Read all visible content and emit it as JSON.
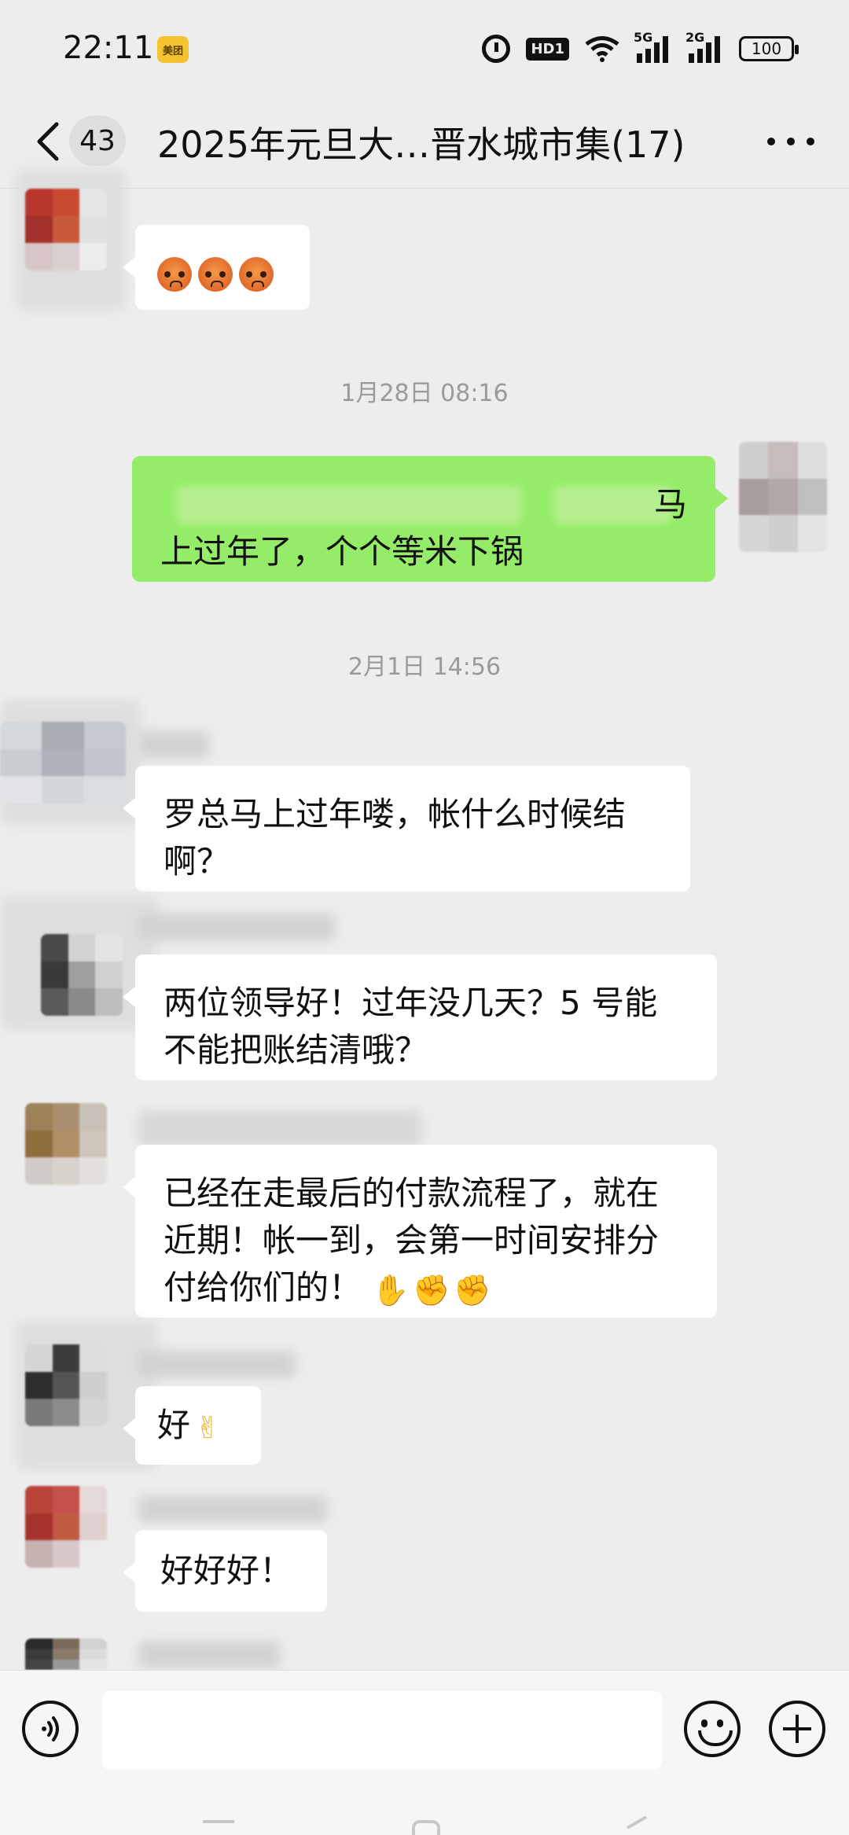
{
  "status_bar": {
    "time": "22:11",
    "app_badge": "美团",
    "hd_label": "HD1",
    "signal_1_label": "5G",
    "signal_2_label": "2G",
    "battery": "100",
    "icons": [
      "alarm-icon",
      "wifi-icon",
      "signal-icon",
      "battery-icon"
    ]
  },
  "header": {
    "unread_count": "43",
    "title": "2025年元旦大…晋水城市集(17)",
    "icons": [
      "back-chevron-icon",
      "more-dots-icon"
    ]
  },
  "messages": {
    "m1": {
      "side": "left",
      "emojis": [
        "sweat-face-emoji",
        "sweat-face-emoji",
        "sweat-face-emoji"
      ]
    },
    "ts1": "1月28日 08:16",
    "m2": {
      "side": "right",
      "line1_tail": "马",
      "line2": "上过年了，个个等米下锅"
    },
    "ts2": "2月1日 14:56",
    "m3": {
      "side": "left",
      "line1": "罗总马上过年喽，帐什么时候结",
      "line2": "啊？"
    },
    "m4": {
      "side": "left",
      "line1": "两位领导好！过年没几天？5 号能",
      "line2": "不能把账结清哦？"
    },
    "m5": {
      "side": "left",
      "line1": "已经在走最后的付款流程了，就在",
      "line2": "近期！帐一到，会第一时间安排分",
      "line3": "付给你们的！",
      "emojis": [
        "clap-hands-emoji",
        "handshake-emoji",
        "handshake-emoji"
      ]
    },
    "m6": {
      "side": "left",
      "text": "好",
      "emojis": [
        "ok-hand-emoji"
      ]
    },
    "m7": {
      "side": "left",
      "text": "好好好！"
    }
  },
  "input_bar": {
    "placeholder": "",
    "icons": [
      "voice-icon",
      "emoji-icon",
      "plus-icon"
    ]
  },
  "colors": {
    "background": "#ededed",
    "outgoing_bubble": "#95ec69",
    "incoming_bubble": "#ffffff",
    "timestamp_text": "#9a9a9a"
  }
}
